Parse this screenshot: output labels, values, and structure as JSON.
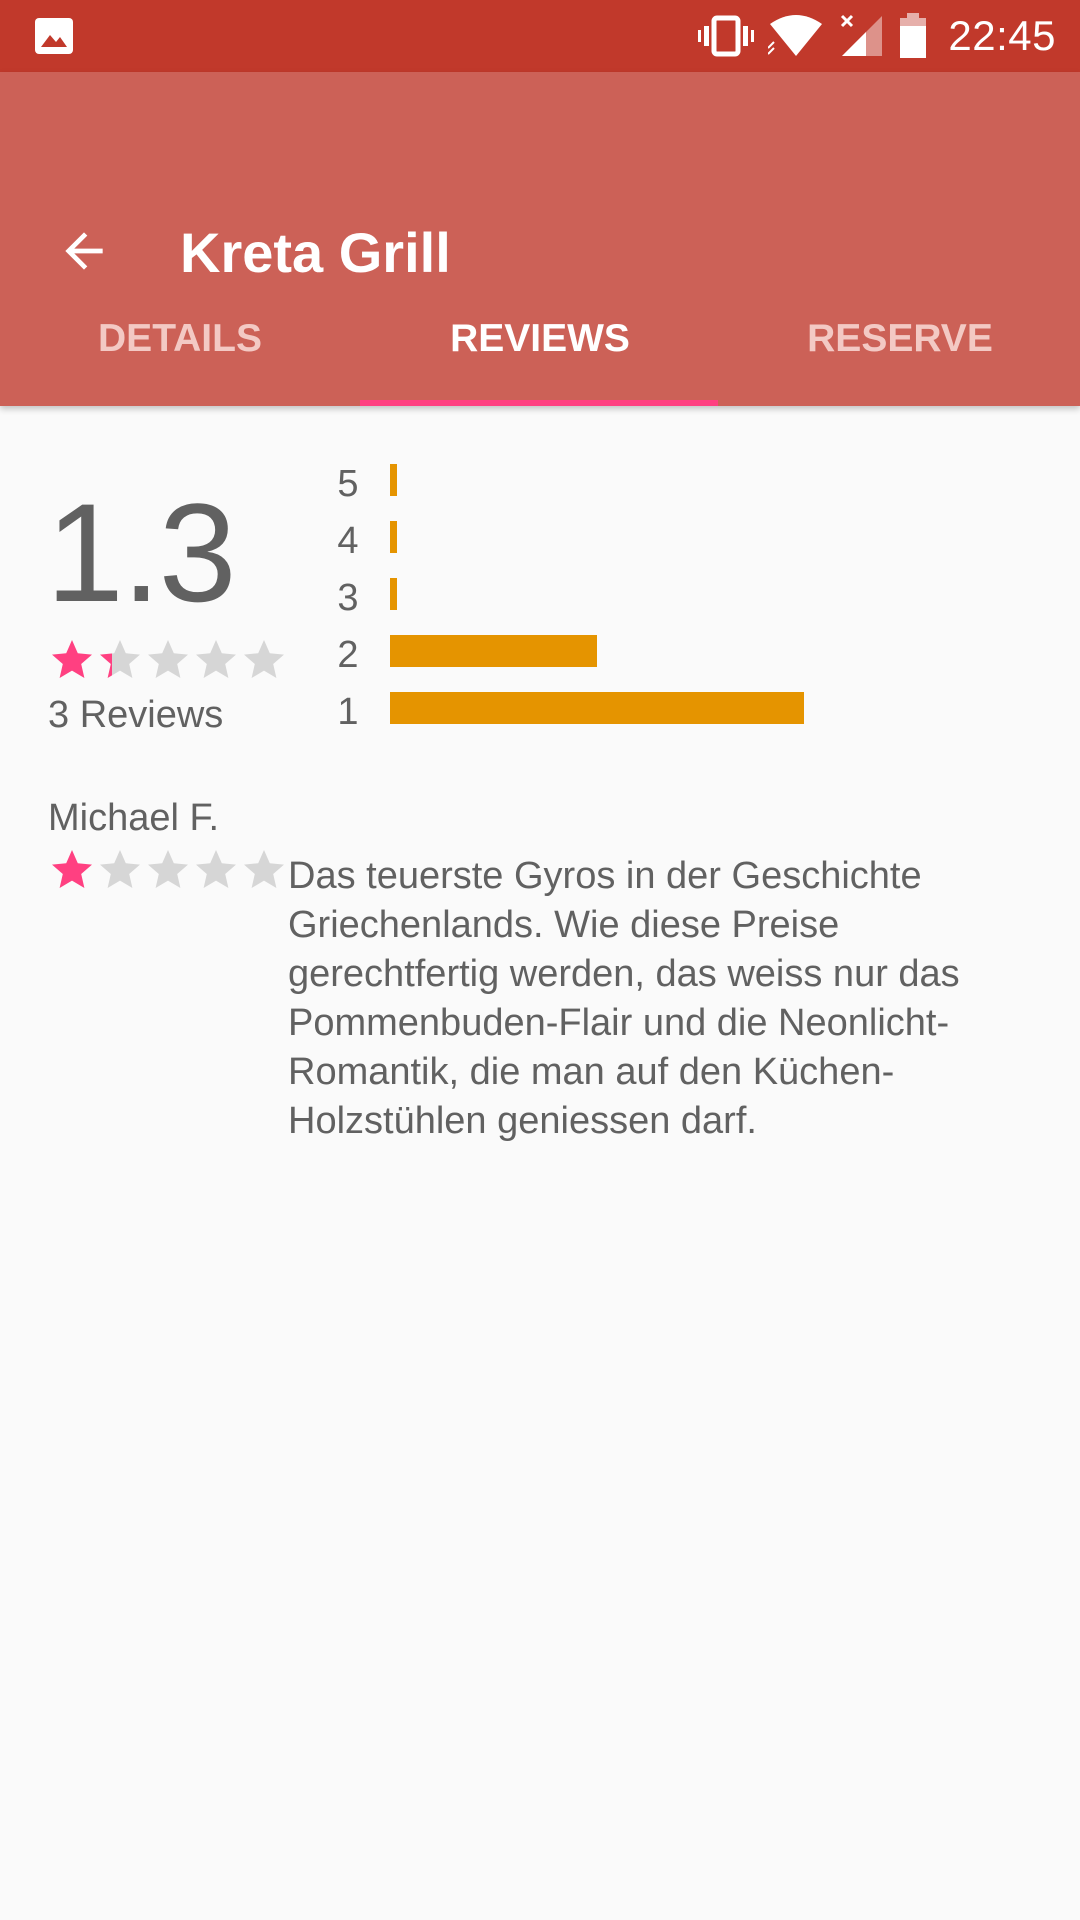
{
  "status_bar": {
    "time": "22:45",
    "icons": [
      "gallery-icon",
      "vibrate-icon",
      "wifi-icon",
      "cellular-icon",
      "battery-icon"
    ]
  },
  "app_bar": {
    "title": "Kreta Grill",
    "back_icon": "arrow-back-icon",
    "background": "#cc6157"
  },
  "tabs": [
    {
      "label": "DETAILS",
      "active": false
    },
    {
      "label": "REVIEWS",
      "active": true
    },
    {
      "label": "RESERVE",
      "active": false
    }
  ],
  "colors": {
    "status_bar": "#c1392b",
    "accent": "#ff4081",
    "star_filled": "#ff4081",
    "star_empty": "#d6d6d6",
    "histogram_bar": "#e59400"
  },
  "summary": {
    "rating": "1.3",
    "rating_value": 1.3,
    "stars_max": 5,
    "reviews_count_label": "3 Reviews"
  },
  "chart_data": {
    "type": "bar",
    "orientation": "horizontal",
    "categories": [
      "5",
      "4",
      "3",
      "2",
      "1"
    ],
    "values": [
      0,
      0,
      0,
      1,
      2
    ],
    "max": 2
  },
  "review": {
    "author": "Michael F.",
    "rating": 1,
    "stars_max": 5,
    "text": "Das teuerste Gyros in der Geschichte Griechenlands. Wie diese Preise gerechtfertig werden, das weiss nur das Pommenbuden-Flair und die Neonlicht-Romantik, die man auf den Küchen-Holzstühlen geniessen darf."
  }
}
